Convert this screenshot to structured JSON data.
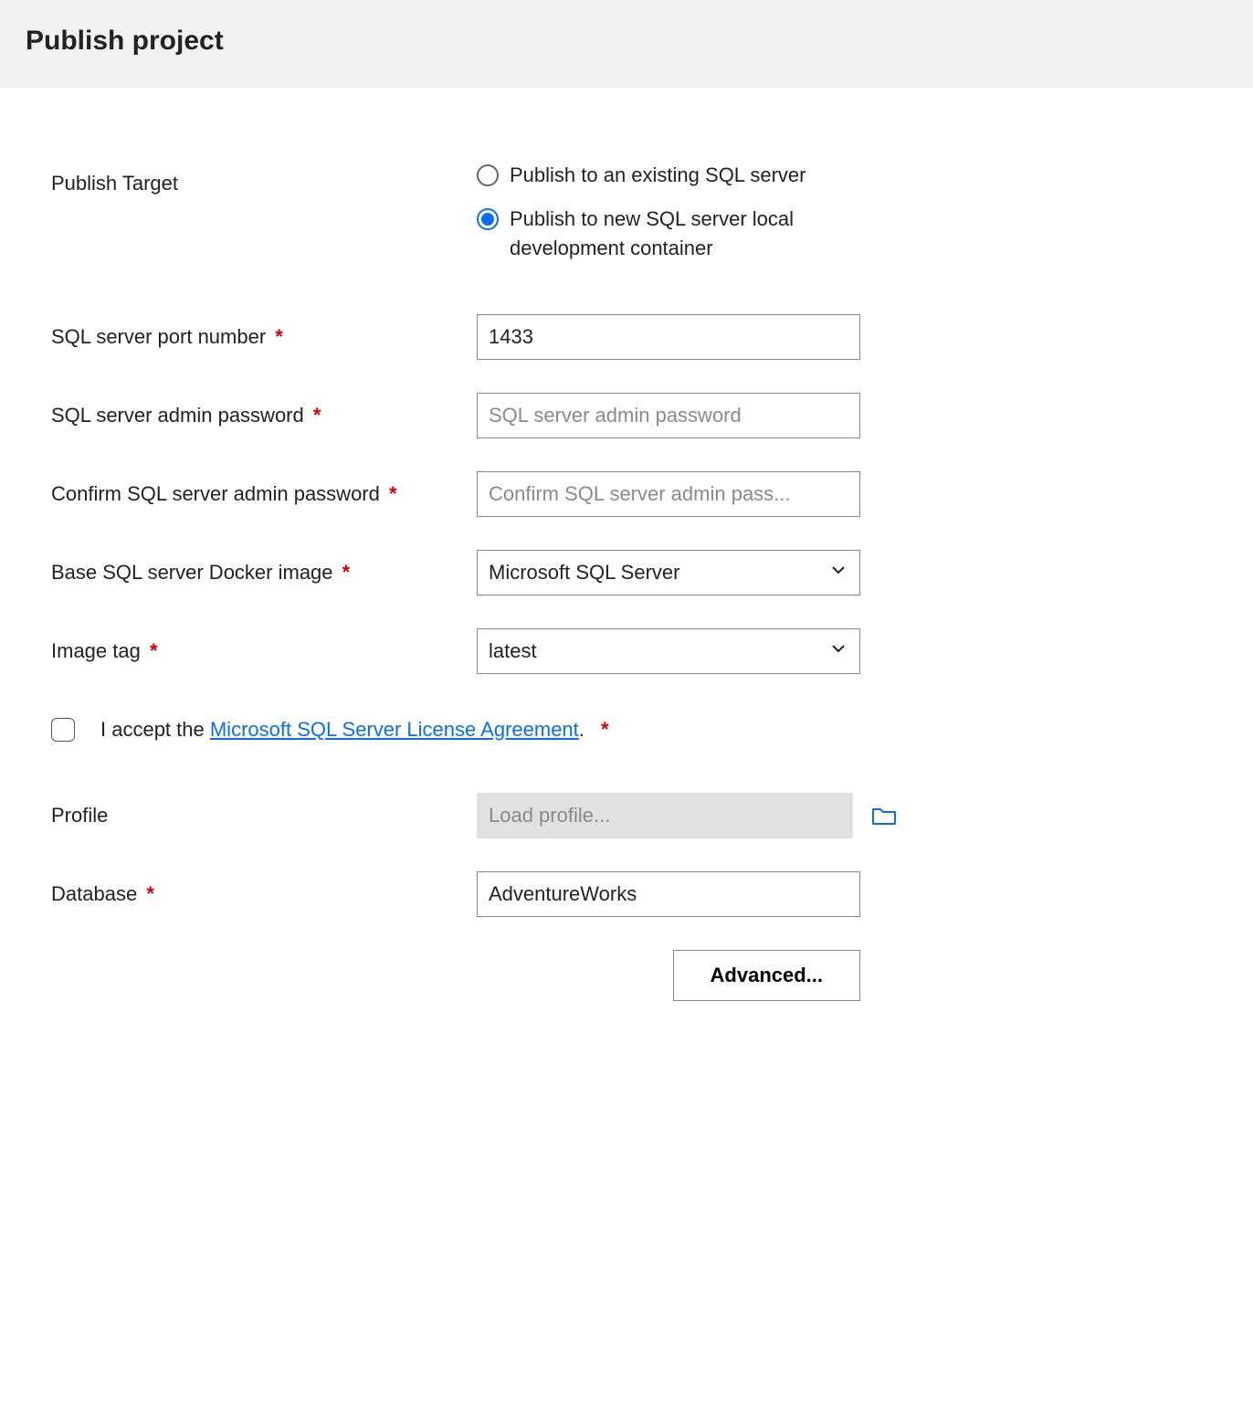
{
  "header": {
    "title": "Publish project"
  },
  "labels": {
    "publish_target": "Publish Target",
    "port": "SQL server port number",
    "admin_password": "SQL server admin password",
    "confirm_admin_password": "Confirm SQL server admin password",
    "docker_image": "Base SQL server Docker image",
    "image_tag": "Image tag",
    "profile": "Profile",
    "database": "Database"
  },
  "publish_target": {
    "options": {
      "existing": "Publish to an existing SQL server",
      "new_container": "Publish to new SQL server local development container"
    },
    "selected": "new_container"
  },
  "values": {
    "port": "1433",
    "admin_password": "",
    "confirm_admin_password": "",
    "docker_image": "Microsoft SQL Server",
    "image_tag": "latest",
    "profile": "",
    "database": "AdventureWorks"
  },
  "placeholders": {
    "admin_password": "SQL server admin password",
    "confirm_admin_password": "Confirm SQL server admin pass...",
    "profile": "Load profile..."
  },
  "license": {
    "prefix": "I accept the ",
    "link_text": "Microsoft SQL Server License Agreement",
    "suffix": ".",
    "accepted": false
  },
  "buttons": {
    "advanced": "Advanced..."
  },
  "required_marker": "*"
}
